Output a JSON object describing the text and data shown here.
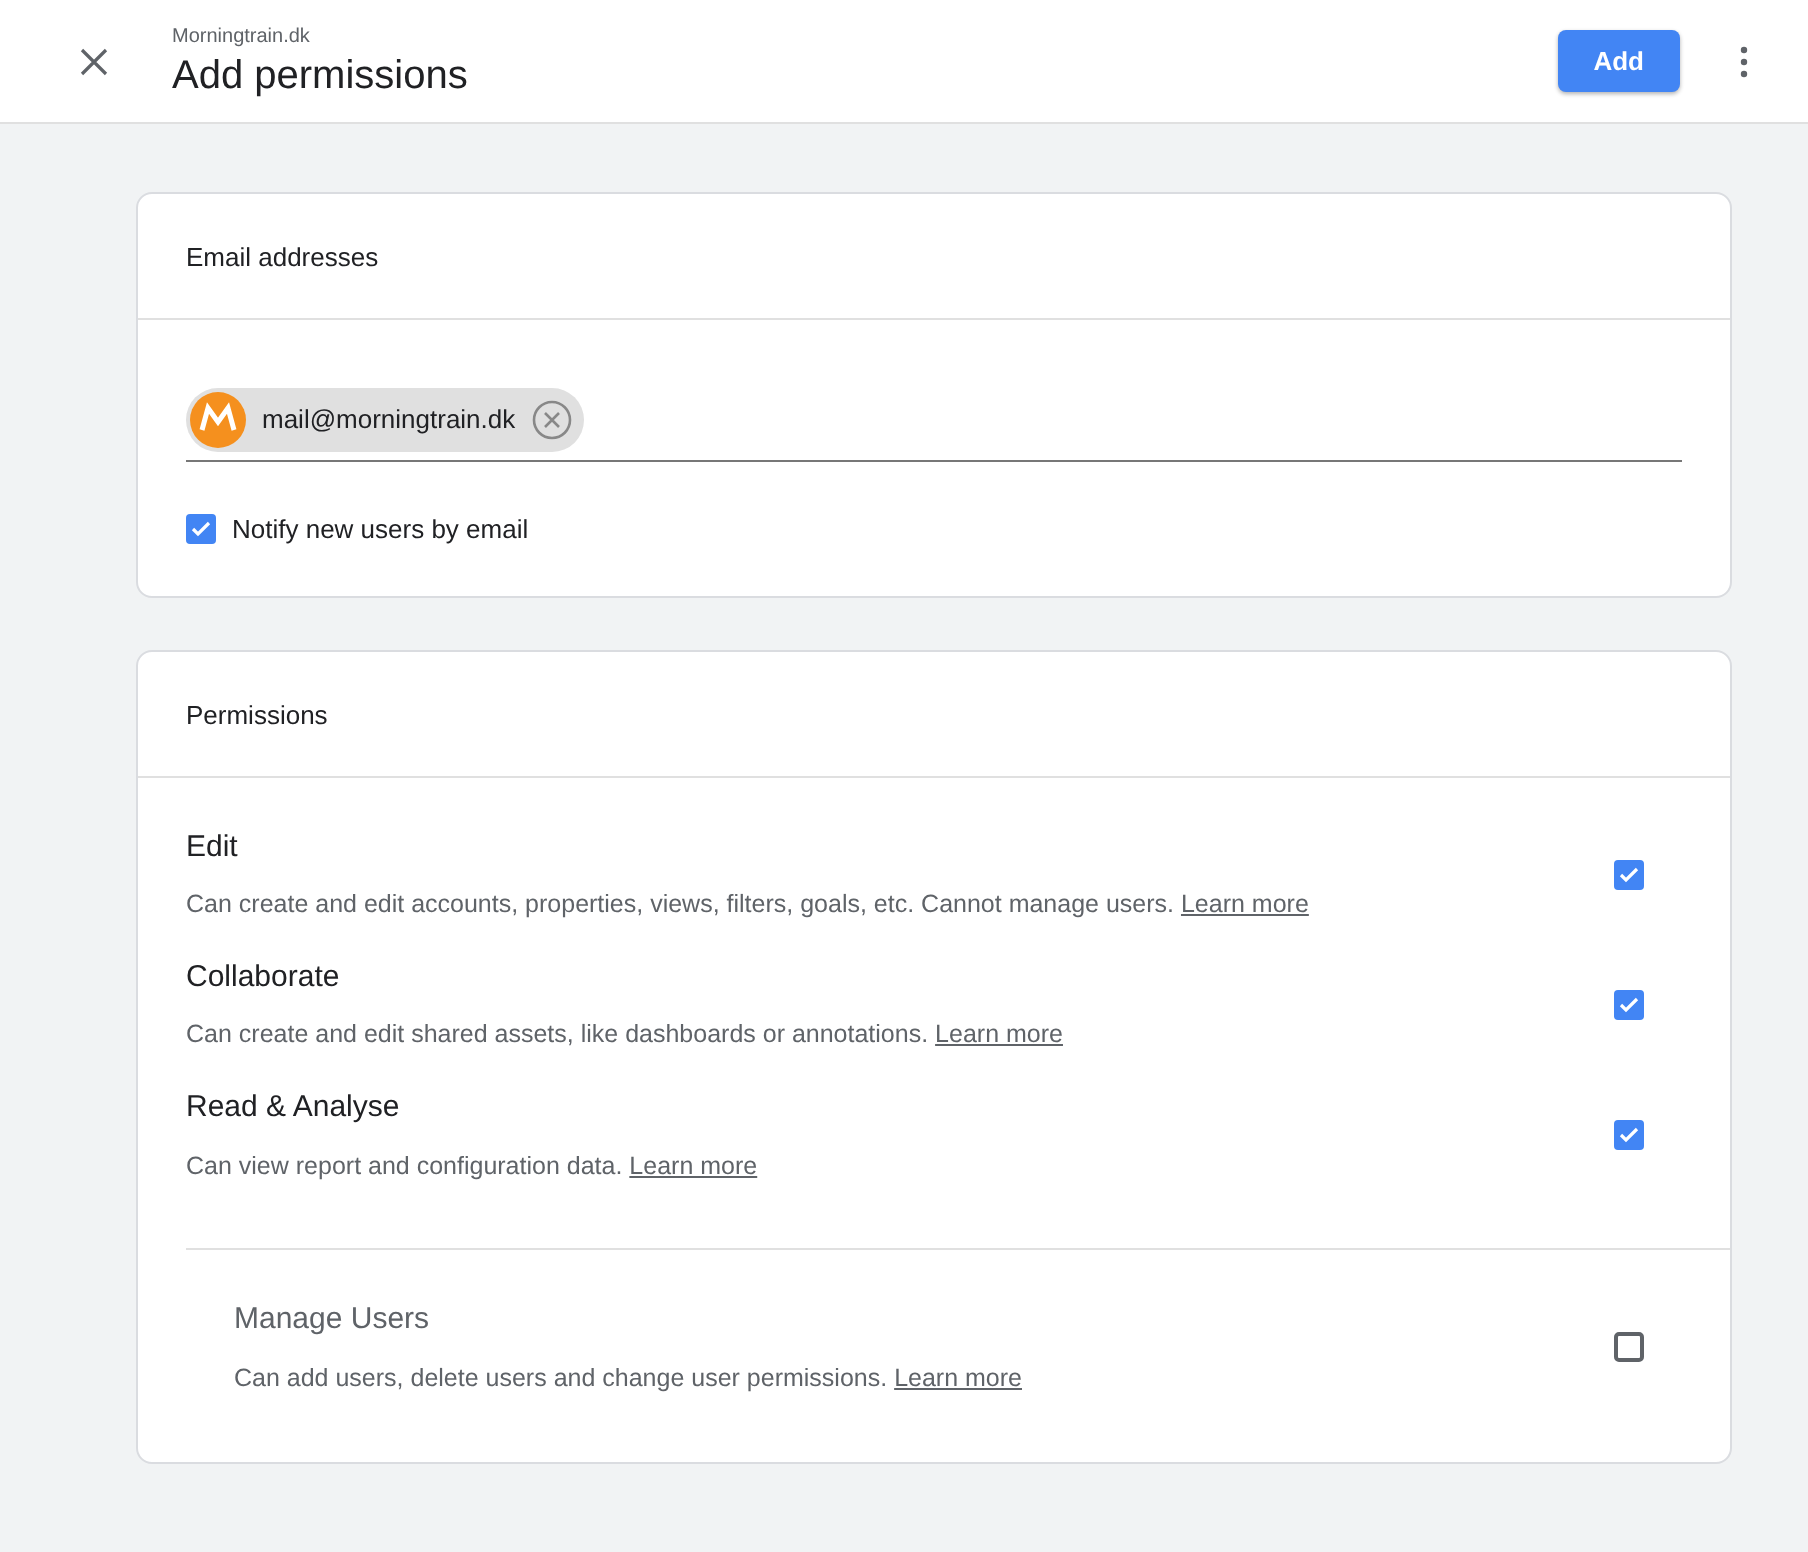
{
  "header": {
    "subtitle": "Morningtrain.dk",
    "title": "Add permissions",
    "add_button": "Add"
  },
  "email_card": {
    "heading": "Email addresses",
    "chips": [
      {
        "email": "mail@morningtrain.dk"
      }
    ],
    "notify": {
      "label": "Notify new users by email",
      "checked": true
    }
  },
  "permissions_card": {
    "heading": "Permissions",
    "groups": [
      {
        "items": [
          {
            "name": "Edit",
            "description": "Can create and edit accounts, properties, views, filters, goals, etc. Cannot manage users.",
            "link": "Learn more",
            "checked": true
          },
          {
            "name": "Collaborate",
            "description": "Can create and edit shared assets, like dashboards or annotations.",
            "link": "Learn more",
            "checked": true
          },
          {
            "name": "Read & Analyse",
            "description": "Can view report and configuration data.",
            "link": "Learn more",
            "checked": true
          }
        ]
      },
      {
        "items": [
          {
            "name": "Manage Users",
            "description": "Can add users, delete users and change user permissions.",
            "link": "Learn more",
            "checked": false
          }
        ]
      }
    ]
  }
}
